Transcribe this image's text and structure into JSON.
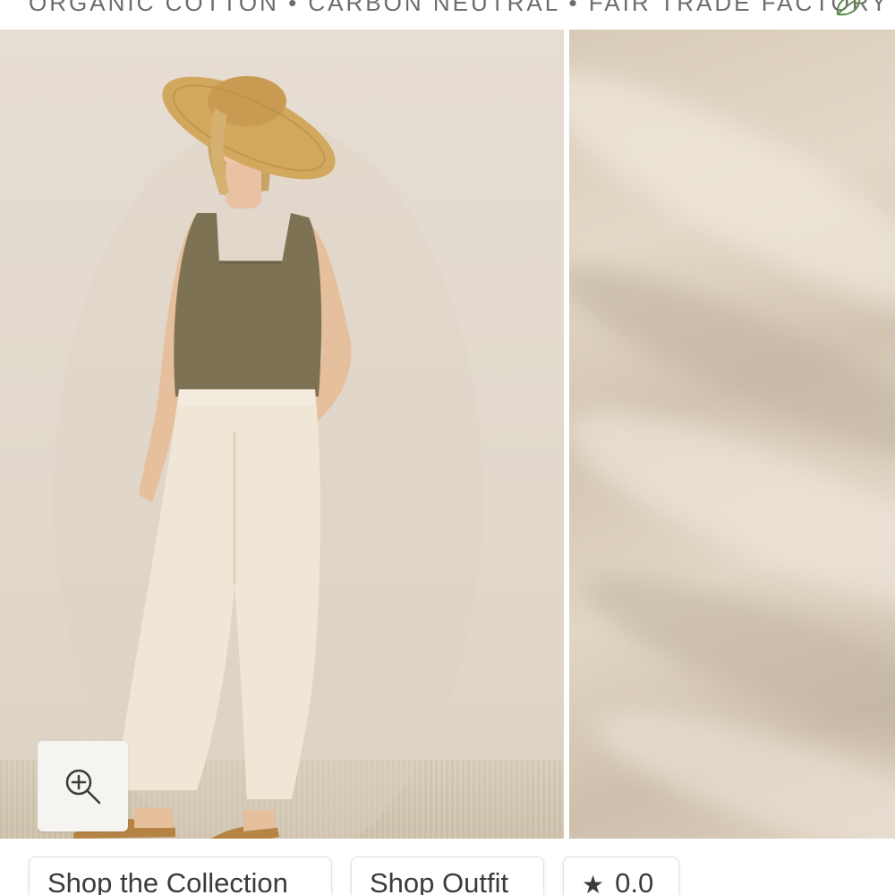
{
  "banner": {
    "text": "ORGANIC COTTON • CARBON NEUTRAL • FAIR TRADE FACTORY",
    "icon": "leaf-icon",
    "accent_color": "#5a8a4a"
  },
  "gallery": {
    "images": [
      {
        "name": "model-photo",
        "alt": "Model wearing olive square-neck tank, cream wide-leg pants and straw hat"
      },
      {
        "name": "fabric-closeup",
        "alt": "Close-up of beige linen fabric texture"
      }
    ],
    "zoom_icon": "zoom-in-icon"
  },
  "actions": {
    "shop_collection": "Shop the Collection",
    "shop_outfit": "Shop Outfit",
    "rating_icon": "star-icon",
    "rating_value": "0.0"
  }
}
